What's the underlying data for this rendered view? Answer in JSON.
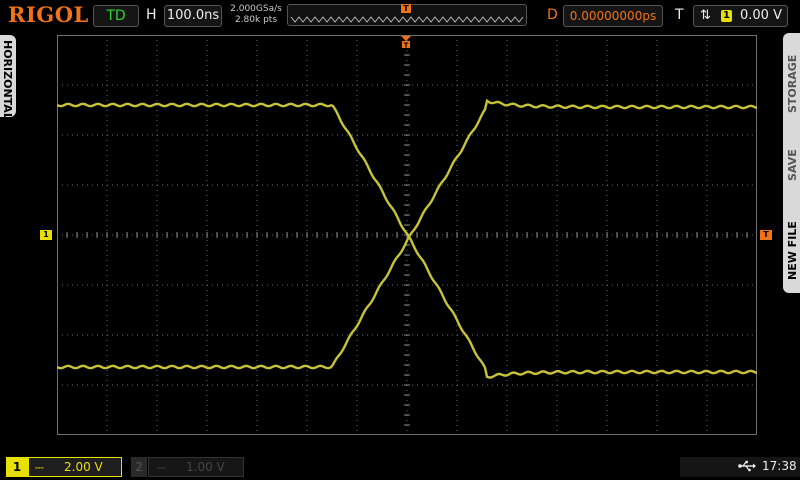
{
  "header": {
    "logo": "RIGOL",
    "run_status": "TD",
    "horizontal_label": "H",
    "timebase": "100.0ns",
    "sample_rate": "2.000GSa/s",
    "memory_depth": "2.80k pts",
    "trigger_position_marker": "T",
    "delay_label": "D",
    "delay_value": "0.00000000ps",
    "trigger_label": "T",
    "trigger_edge": "⇅",
    "trigger_source": "1",
    "trigger_level": "0.00 V"
  },
  "side_menus": {
    "left": "HORIZONTAL",
    "right_items": [
      "STORAGE",
      "SAVE",
      "NEW FILE"
    ]
  },
  "markers": {
    "channel1_ground": "1",
    "trigger_level": "T"
  },
  "footer": {
    "ch1_number": "1",
    "ch1_coupling": "⎓",
    "ch1_scale": "2.00 V",
    "ch2_number": "2",
    "ch2_coupling": "⎓",
    "ch2_scale": "1.00 V",
    "usb_icon": "usb-icon",
    "clock": "17:38"
  },
  "colors": {
    "trace": "#c8c23a",
    "accent": "#f0731a",
    "ch1": "#e8e000",
    "status": "#2fd52f",
    "grid": "#6a6a6a"
  }
}
